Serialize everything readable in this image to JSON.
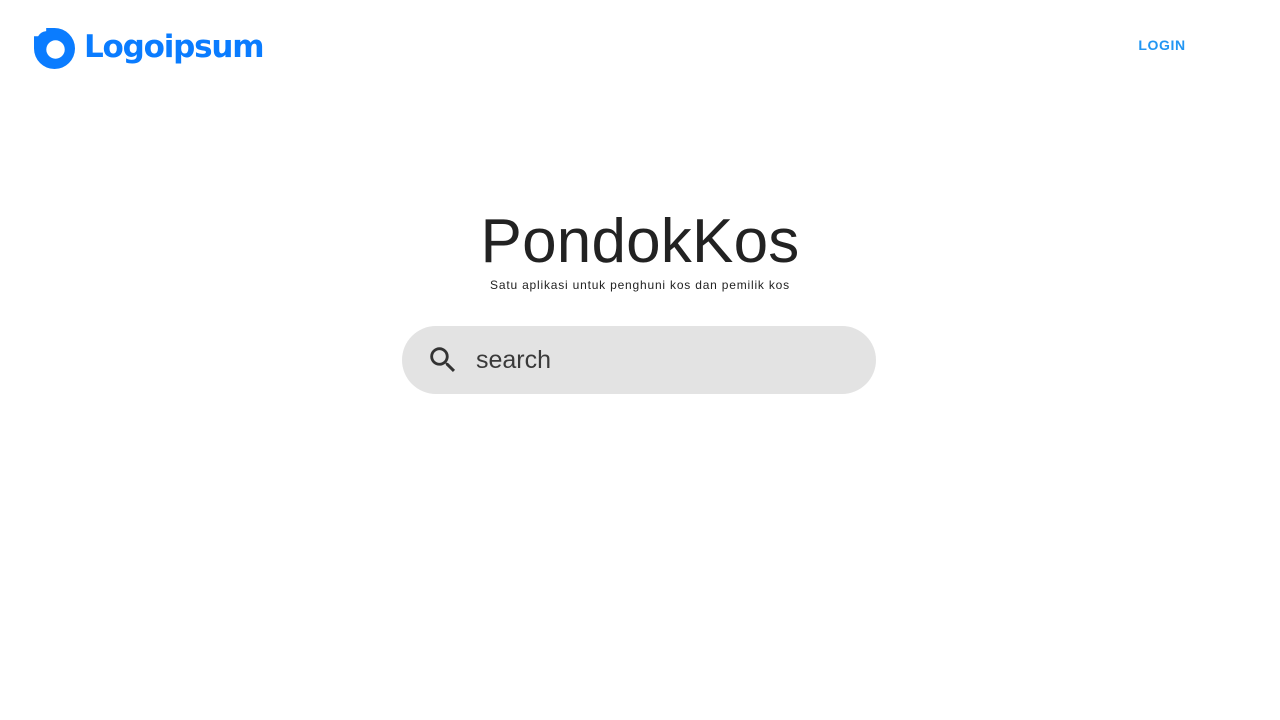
{
  "header": {
    "logo": {
      "icon": "logo-mark-icon",
      "text": "Logoipsum"
    },
    "login_label": "LOGIN"
  },
  "hero": {
    "title": "PondokKos",
    "subtitle": "Satu aplikasi untuk penghuni kos dan pemilik kos"
  },
  "search": {
    "icon": "search-icon",
    "placeholder": "search",
    "value": ""
  },
  "colors": {
    "brand": "#0a7cff",
    "login": "#2196f3",
    "search_bg": "#e3e3e3",
    "text": "#222222"
  }
}
